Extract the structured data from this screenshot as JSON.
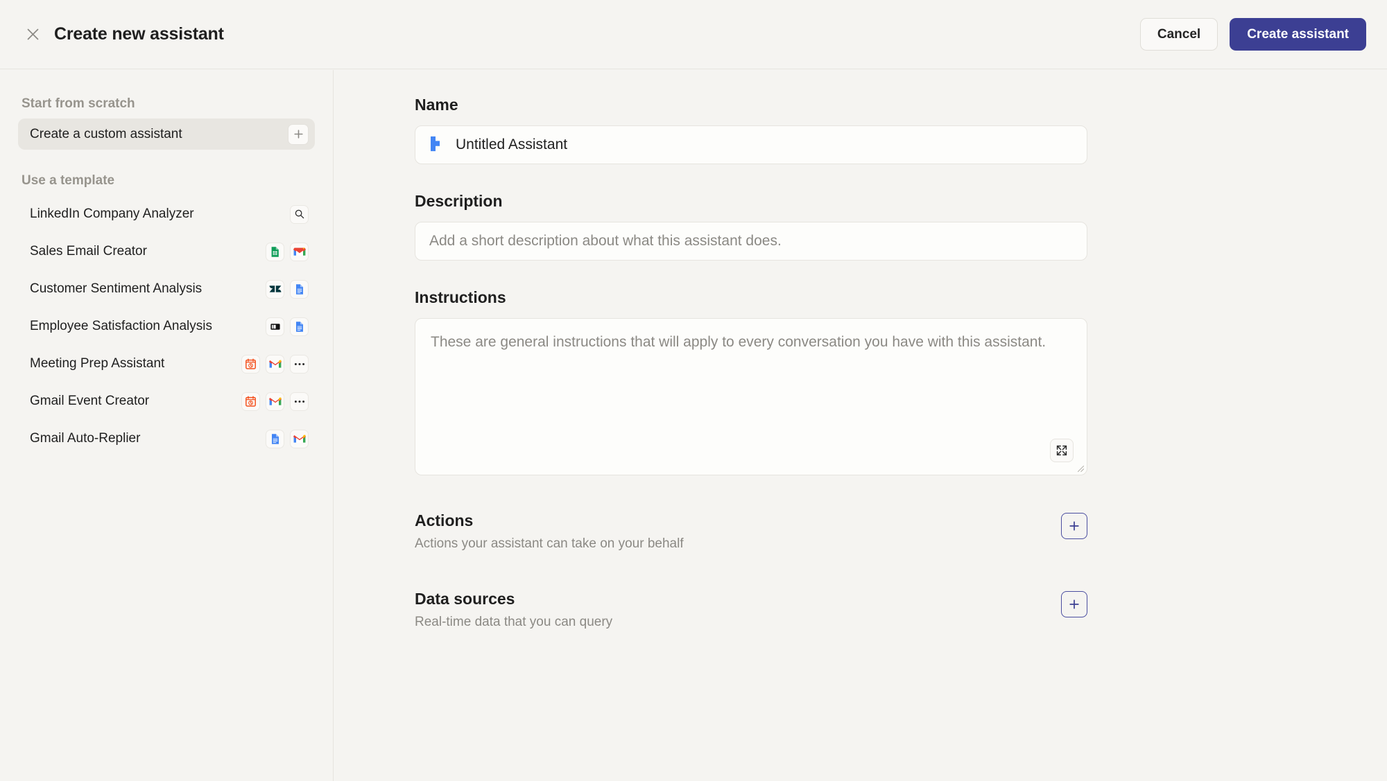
{
  "window": {
    "title": "Create new assistant",
    "close_icon": "close-icon"
  },
  "header": {
    "cancel_label": "Cancel",
    "create_label": "Create assistant",
    "primary_color": "#3c3f93"
  },
  "sidebar": {
    "scratch_heading": "Start from scratch",
    "scratch_item": {
      "label": "Create a custom assistant",
      "add_icon": "plus-icon"
    },
    "template_heading": "Use a template",
    "templates": [
      {
        "label": "LinkedIn Company Analyzer",
        "icons": [
          "search-icon"
        ]
      },
      {
        "label": "Sales Email Creator",
        "icons": [
          "google-sheets-icon",
          "gmail-icon"
        ]
      },
      {
        "label": "Customer Sentiment Analysis",
        "icons": [
          "zendesk-icon",
          "google-docs-icon"
        ]
      },
      {
        "label": "Employee Satisfaction Analysis",
        "icons": [
          "survey-icon",
          "google-docs-icon"
        ]
      },
      {
        "label": "Meeting Prep Assistant",
        "icons": [
          "google-calendar-icon",
          "gmail-icon",
          "more-icon"
        ]
      },
      {
        "label": "Gmail Event Creator",
        "icons": [
          "google-calendar-icon",
          "gmail-icon",
          "more-icon"
        ]
      },
      {
        "label": "Gmail Auto-Replier",
        "icons": [
          "google-docs-icon",
          "gmail-icon"
        ]
      }
    ]
  },
  "form": {
    "name": {
      "label": "Name",
      "value": "Untitled Assistant",
      "avatar_icon": "assistant-logo-icon",
      "avatar_color": "#4285f4"
    },
    "description": {
      "label": "Description",
      "value": "",
      "placeholder": "Add a short description about what this assistant does."
    },
    "instructions": {
      "label": "Instructions",
      "value": "",
      "placeholder": "These are general instructions that will apply to every conversation you have with this assistant.",
      "expand_icon": "expand-icon",
      "resize_icon": "resize-grip-icon"
    },
    "actions": {
      "title": "Actions",
      "subtitle": "Actions your assistant can take on your behalf",
      "add_icon": "plus-icon"
    },
    "data_sources": {
      "title": "Data sources",
      "subtitle": "Real-time data that you can query",
      "add_icon": "plus-icon"
    }
  }
}
